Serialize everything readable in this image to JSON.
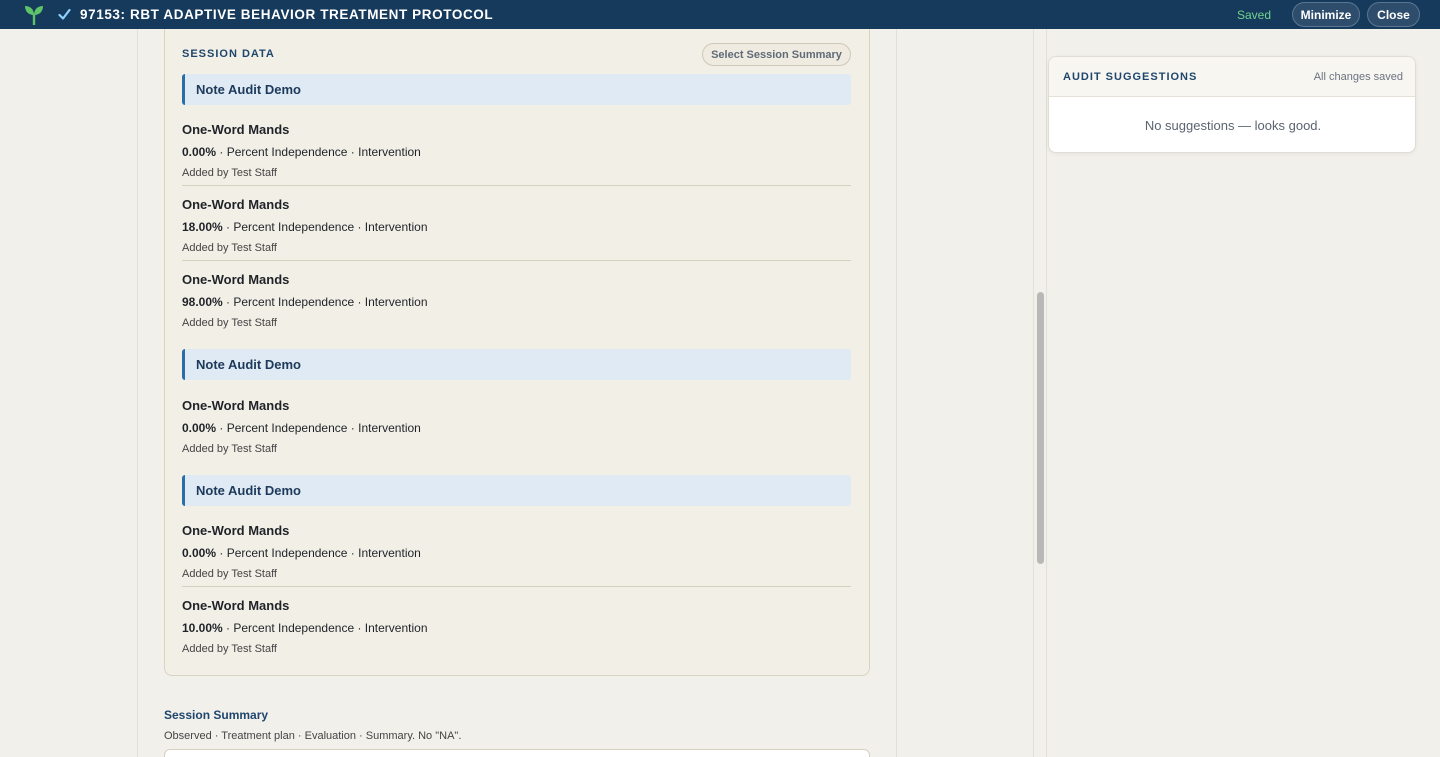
{
  "header": {
    "title": "97153: RBT ADAPTIVE BEHAVIOR TREATMENT PROTOCOL",
    "saved_label": "Saved",
    "minimize_label": "Minimize",
    "close_label": "Close",
    "logo_icon": "sprout-logo-icon",
    "check_icon": "check-icon"
  },
  "session": {
    "label": "SESSION DATA",
    "select_summary_label": "Select Session Summary",
    "groups": [
      {
        "header": "Note Audit Demo",
        "entries": [
          {
            "title": "One-Word Mands",
            "value": "0.00%",
            "detail": " · Percent Independence · Intervention",
            "added": "Added by Test Staff"
          },
          {
            "title": "One-Word Mands",
            "value": "18.00%",
            "detail": " · Percent Independence · Intervention",
            "added": "Added by Test Staff"
          },
          {
            "title": "One-Word Mands",
            "value": "98.00%",
            "detail": " · Percent Independence · Intervention",
            "added": "Added by Test Staff"
          }
        ]
      },
      {
        "header": "Note Audit Demo",
        "entries": [
          {
            "title": "One-Word Mands",
            "value": "0.00%",
            "detail": " · Percent Independence · Intervention",
            "added": "Added by Test Staff"
          }
        ]
      },
      {
        "header": "Note Audit Demo",
        "entries": [
          {
            "title": "One-Word Mands",
            "value": "0.00%",
            "detail": " · Percent Independence · Intervention",
            "added": "Added by Test Staff"
          },
          {
            "title": "One-Word Mands",
            "value": "10.00%",
            "detail": " · Percent Independence · Intervention",
            "added": "Added by Test Staff"
          }
        ]
      }
    ]
  },
  "summary": {
    "label": "Session Summary",
    "hint": "Observed · Treatment plan · Evaluation · Summary. No \"NA\"."
  },
  "audit": {
    "title": "AUDIT SUGGESTIONS",
    "status": "All changes saved",
    "empty_message": "No suggestions — looks good."
  },
  "colors": {
    "topbar": "#163a5c",
    "accent": "#2a6ea8",
    "saved": "#73d28f",
    "panel_bg": "#f2efe7"
  }
}
